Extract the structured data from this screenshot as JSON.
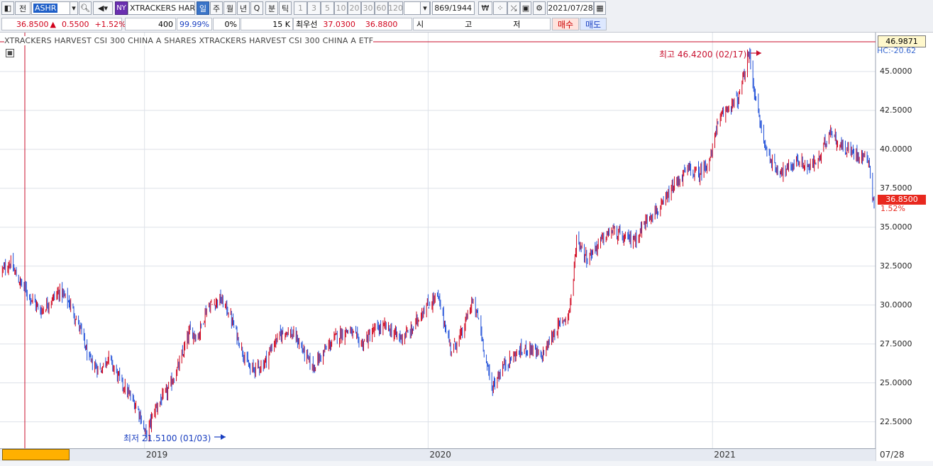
{
  "toolbar": {
    "label_jeon": "전",
    "ticker": "ASHR",
    "exchange_badge": "NY",
    "name": "XTRACKERS HARVE",
    "periods": [
      "일",
      "주",
      "월",
      "년",
      "Q",
      "분",
      "틱"
    ],
    "intervals": [
      "1",
      "3",
      "5",
      "10",
      "20",
      "30",
      "60",
      "120"
    ],
    "count": "869",
    "total": "/1944",
    "date": "2021/07/28"
  },
  "quote": {
    "price": "36.8500",
    "change": "0.5500",
    "change_pct": "+1.52%",
    "volume": "400",
    "ratio": "99.99%",
    "ratio2": "0%",
    "amount": "15 K",
    "bid_label": "최우선",
    "bid": "37.0300",
    "ask": "36.8800",
    "open_label": "시",
    "high_label": "고",
    "low_label": "저",
    "buy_label": "매수",
    "sell_label": "매도"
  },
  "chart_data": {
    "type": "candlestick",
    "title": "XTRACKERS HARVEST CSI 300 CHINA A  SHARES  XTRACKERS HARVEST CSI 300 CHINA A  ETF",
    "ylim": [
      20.8,
      47.5
    ],
    "yticks": [
      "45.0000",
      "42.5000",
      "40.0000",
      "37.5000",
      "35.0000",
      "32.5000",
      "30.0000",
      "27.5000",
      "25.0000",
      "22.5000"
    ],
    "ytick_values": [
      45,
      42.5,
      40,
      37.5,
      35,
      32.5,
      30,
      27.5,
      25,
      22.5
    ],
    "xlabels": [
      "2019",
      "2020",
      "2021"
    ],
    "last_date_label": "07/28",
    "top_price_box": "46.9871",
    "hc_label": "HC:-20.62",
    "current_price": "36.8500",
    "current_pct": "1.52%",
    "high_label": "최고 46.4200 (02/17)",
    "low_label": "최저 21.5100 (01/03)",
    "up_color": "#d0021b",
    "down_color": "#1f4fd8",
    "grid": true,
    "anchors": [
      [
        "2018-07-02",
        32.2
      ],
      [
        "2018-07-12",
        32.7
      ],
      [
        "2018-07-24",
        31.5
      ],
      [
        "2018-08-06",
        30.6
      ],
      [
        "2018-08-20",
        29.6
      ],
      [
        "2018-09-04",
        30.4
      ],
      [
        "2018-09-14",
        30.9
      ],
      [
        "2018-09-28",
        30.0
      ],
      [
        "2018-10-10",
        28.5
      ],
      [
        "2018-10-22",
        26.4
      ],
      [
        "2018-11-05",
        25.8
      ],
      [
        "2018-11-15",
        26.7
      ],
      [
        "2018-11-28",
        25.4
      ],
      [
        "2018-12-10",
        24.4
      ],
      [
        "2018-12-24",
        23.3
      ],
      [
        "2019-01-03",
        21.6
      ],
      [
        "2019-01-15",
        23.4
      ],
      [
        "2019-01-31",
        24.5
      ],
      [
        "2019-02-15",
        26.2
      ],
      [
        "2019-02-28",
        28.3
      ],
      [
        "2019-03-11",
        28.0
      ],
      [
        "2019-03-22",
        29.8
      ],
      [
        "2019-04-08",
        30.4
      ],
      [
        "2019-04-19",
        29.6
      ],
      [
        "2019-05-06",
        27.2
      ],
      [
        "2019-05-17",
        25.8
      ],
      [
        "2019-06-03",
        26.2
      ],
      [
        "2019-06-17",
        27.6
      ],
      [
        "2019-07-01",
        28.4
      ],
      [
        "2019-07-15",
        27.9
      ],
      [
        "2019-08-05",
        26.0
      ],
      [
        "2019-08-20",
        27.0
      ],
      [
        "2019-09-05",
        28.0
      ],
      [
        "2019-09-20",
        28.4
      ],
      [
        "2019-10-08",
        27.5
      ],
      [
        "2019-10-24",
        28.4
      ],
      [
        "2019-11-08",
        28.6
      ],
      [
        "2019-11-25",
        27.9
      ],
      [
        "2019-12-10",
        28.3
      ],
      [
        "2019-12-24",
        29.6
      ],
      [
        "2020-01-13",
        30.6
      ],
      [
        "2020-01-31",
        27.1
      ],
      [
        "2020-02-14",
        28.2
      ],
      [
        "2020-02-26",
        30.2
      ],
      [
        "2020-03-06",
        29.1
      ],
      [
        "2020-03-16",
        26.3
      ],
      [
        "2020-03-23",
        24.7
      ],
      [
        "2020-04-07",
        26.1
      ],
      [
        "2020-04-24",
        26.9
      ],
      [
        "2020-05-11",
        27.3
      ],
      [
        "2020-05-25",
        26.6
      ],
      [
        "2020-06-12",
        28.3
      ],
      [
        "2020-06-30",
        29.5
      ],
      [
        "2020-07-06",
        31.7
      ],
      [
        "2020-07-10",
        34.3
      ],
      [
        "2020-07-24",
        33.0
      ],
      [
        "2020-08-10",
        34.1
      ],
      [
        "2020-08-25",
        34.8
      ],
      [
        "2020-09-10",
        34.2
      ],
      [
        "2020-09-25",
        34.3
      ],
      [
        "2020-10-12",
        35.8
      ],
      [
        "2020-10-27",
        36.2
      ],
      [
        "2020-11-12",
        37.6
      ],
      [
        "2020-11-30",
        38.7
      ],
      [
        "2020-12-15",
        38.4
      ],
      [
        "2020-12-31",
        39.6
      ],
      [
        "2021-01-05",
        41.3
      ],
      [
        "2021-01-20",
        42.7
      ],
      [
        "2021-02-03",
        43.2
      ],
      [
        "2021-02-10",
        44.6
      ],
      [
        "2021-02-17",
        46.2
      ],
      [
        "2021-02-26",
        43.0
      ],
      [
        "2021-03-09",
        40.3
      ],
      [
        "2021-03-22",
        38.8
      ],
      [
        "2021-04-06",
        38.6
      ],
      [
        "2021-04-20",
        39.3
      ],
      [
        "2021-05-05",
        38.8
      ],
      [
        "2021-05-20",
        39.5
      ],
      [
        "2021-06-01",
        41.3
      ],
      [
        "2021-06-15",
        40.2
      ],
      [
        "2021-06-30",
        39.8
      ],
      [
        "2021-07-14",
        39.6
      ],
      [
        "2021-07-21",
        39.4
      ],
      [
        "2021-07-26",
        37.0
      ],
      [
        "2021-07-28",
        36.85
      ]
    ]
  }
}
